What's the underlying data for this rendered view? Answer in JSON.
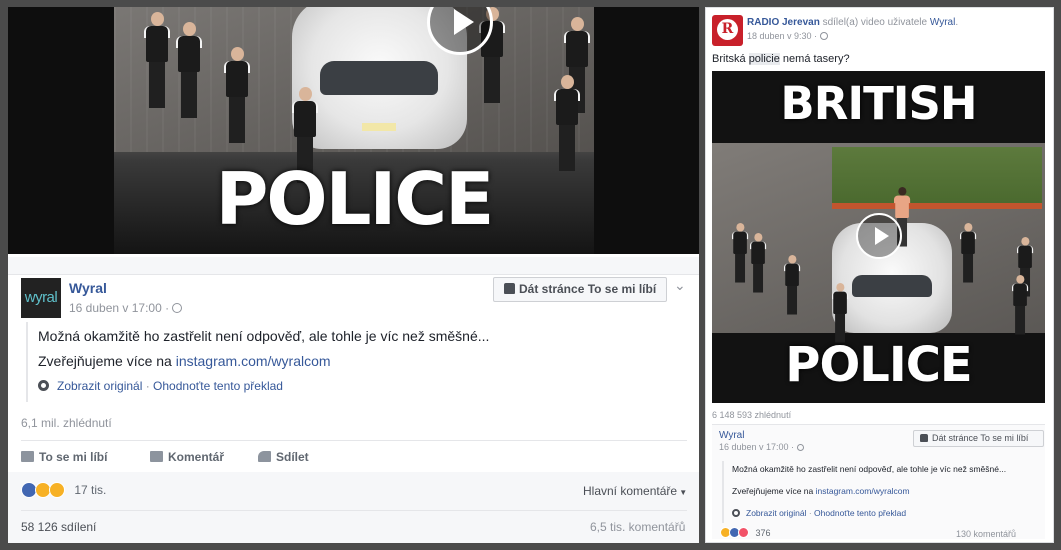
{
  "left_post": {
    "video": {
      "overlay_text": "POLICE"
    },
    "page_name": "Wyral",
    "avatar_text": "wyral",
    "date": "16 duben v 17:00 ·",
    "like_page_button": "Dát stránce To se mi líbí",
    "post_text": "Možná okamžitě ho zastřelit není odpověď, ale tohle je víc než směšné...",
    "post_text2_prefix": "Zveřejňujeme více na ",
    "post_link": "instagram.com/wyralcom",
    "show_original": "Zobrazit originál",
    "rate_translation": "Ohodnoťte tento překlad",
    "views": "6,1 mil. zhlédnutí",
    "actions": {
      "like": "To se mi líbí",
      "comment": "Komentář",
      "share": "Sdílet"
    },
    "reactions_count": "17 tis.",
    "sort_label": "Hlavní komentáře",
    "shares": "58 126 sdílení",
    "comments": "6,5 tis. komentářů"
  },
  "right_post": {
    "page_name": "RADIO Jerevan",
    "shared_text": " sdílel(a) video uživatele ",
    "shared_user": "Wyral",
    "date": "18 duben v 9:30 ·",
    "message_prefix": "Britská ",
    "message_highlight": "policie",
    "message_suffix": " nemá tasery?",
    "video": {
      "top_text": "BRITISH",
      "bottom_text": "POLICE"
    },
    "views": "6 148 593 zhlédnutí",
    "inner": {
      "page_name": "Wyral",
      "date": "16 duben v 17:00 ·",
      "like_page_button": "Dát stránce To se mi líbí",
      "post_text": "Možná okamžitě ho zastřelit není odpověď, ale tohle je víc než směšné...",
      "post_text2_prefix": "Zveřejňujeme více na ",
      "post_link": "instagram.com/wyralcom",
      "show_original": "Zobrazit originál",
      "rate_translation": "Ohodnoťte tento překlad"
    },
    "reactions_count": "376",
    "comments": "130 komentářů"
  },
  "colors": {
    "link": "#365899",
    "muted": "#90949c",
    "like_blue": "#4267b2",
    "haha_yellow": "#f7b125",
    "logo_red": "#c8202a"
  }
}
